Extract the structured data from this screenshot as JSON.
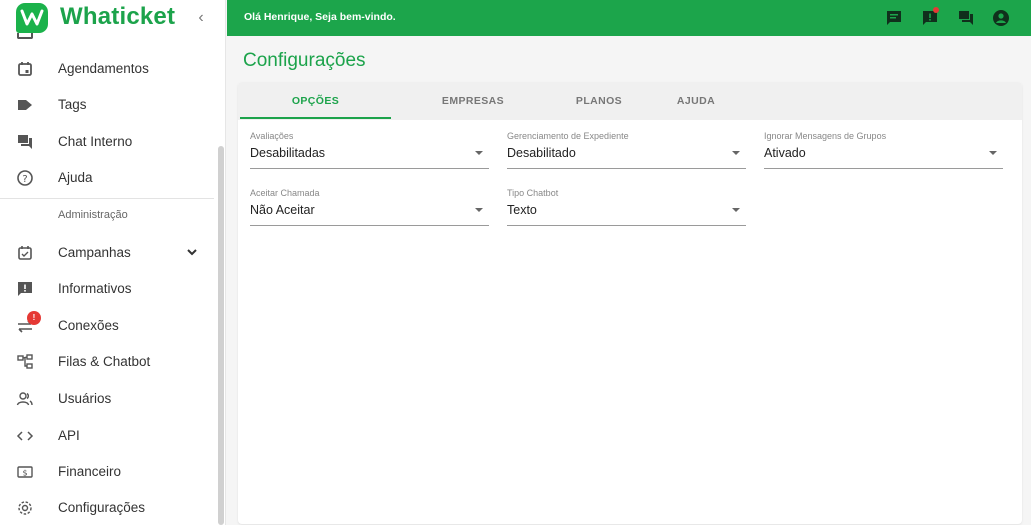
{
  "brand": {
    "name": "Whaticket",
    "collapse_icon": "chevron-left-icon"
  },
  "sidebar": {
    "items_top": [
      {
        "label": "Agendamentos",
        "icon": "calendar-icon"
      },
      {
        "label": "Tags",
        "icon": "tag-icon"
      },
      {
        "label": "Chat Interno",
        "icon": "forum-icon"
      },
      {
        "label": "Ajuda",
        "icon": "help-icon"
      }
    ],
    "section_label": "Administração",
    "items_admin": [
      {
        "label": "Campanhas",
        "icon": "event-check-icon",
        "expandable": true
      },
      {
        "label": "Informativos",
        "icon": "announcement-icon"
      },
      {
        "label": "Conexões",
        "icon": "sync-alt-icon",
        "badge": "!"
      },
      {
        "label": "Filas & Chatbot",
        "icon": "account-tree-icon"
      },
      {
        "label": "Usuários",
        "icon": "people-icon"
      },
      {
        "label": "API",
        "icon": "code-icon"
      },
      {
        "label": "Financeiro",
        "icon": "money-icon"
      },
      {
        "label": "Configurações",
        "icon": "settings-icon"
      }
    ]
  },
  "topbar": {
    "greeting": "Olá Henrique, Seja bem-vindo.",
    "icons": [
      "chat-bubble-icon",
      "announcement-icon",
      "forum-icon",
      "account-circle-icon"
    ]
  },
  "page": {
    "title": "Configurações",
    "tabs": [
      "OPÇÕES",
      "EMPRESAS",
      "PLANOS",
      "AJUDA"
    ],
    "active_tab": "OPÇÕES"
  },
  "settings": {
    "avaliacoes": {
      "label": "Avaliações",
      "value": "Desabilitadas"
    },
    "expediente": {
      "label": "Gerenciamento de Expediente",
      "value": "Desabilitado"
    },
    "ignorar_grupos": {
      "label": "Ignorar Mensagens de Grupos",
      "value": "Ativado"
    },
    "aceitar_chamada": {
      "label": "Aceitar Chamada",
      "value": "Não Aceitar"
    },
    "tipo_chatbot": {
      "label": "Tipo Chatbot",
      "value": "Texto"
    }
  },
  "colors": {
    "brand_green": "#1ca54b",
    "badge_red": "#e53935"
  }
}
